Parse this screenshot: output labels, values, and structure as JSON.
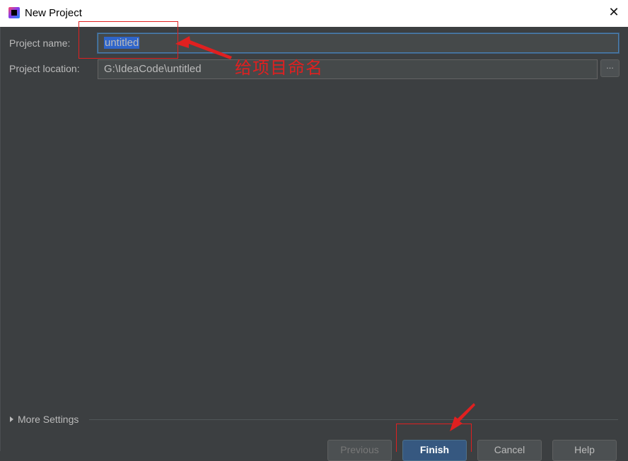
{
  "window": {
    "title": "New Project",
    "close_symbol": "✕"
  },
  "form": {
    "project_name_label": "Project name:",
    "project_name_value": "untitled",
    "project_location_label": "Project location:",
    "project_location_value": "G:\\IdeaCode\\untitled",
    "browse_label": "..."
  },
  "annotation": {
    "text": "给项目命名",
    "color": "#e02020"
  },
  "more_settings": {
    "label": "More Settings"
  },
  "buttons": {
    "previous": "Previous",
    "finish": "Finish",
    "cancel": "Cancel",
    "help": "Help"
  },
  "colors": {
    "background": "#3c3f41",
    "field": "#45494a",
    "selection": "#2f65ca",
    "primary": "#365880"
  }
}
